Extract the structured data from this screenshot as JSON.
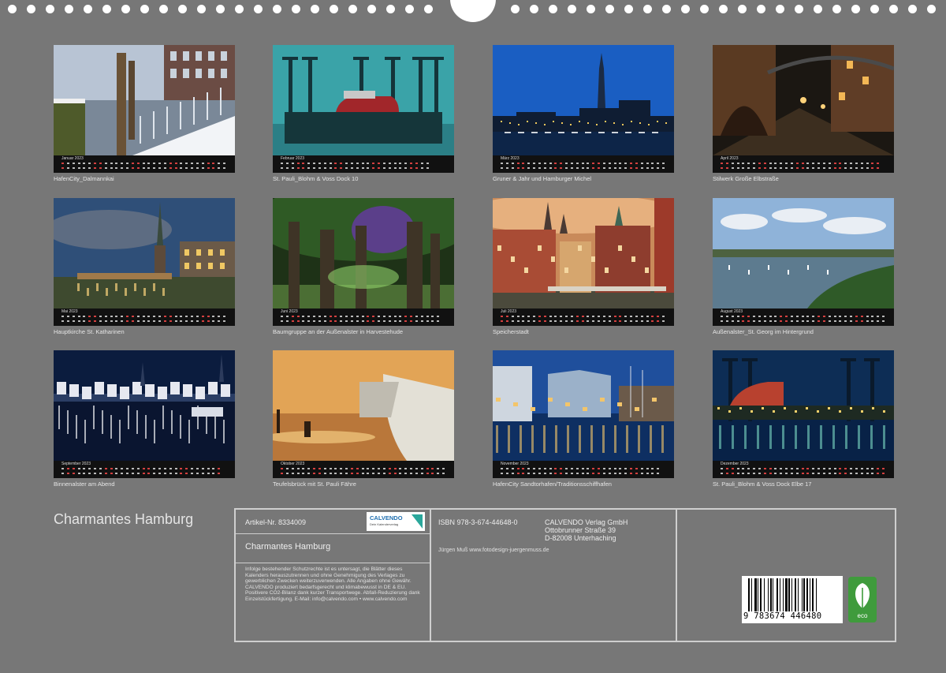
{
  "document": {
    "back_title": "Charmantes Hamburg"
  },
  "calendar_months": [
    {
      "label": "Januar 2023",
      "caption": "HafenCity_Dalmannkai",
      "theme": "winter-harbor"
    },
    {
      "label": "Februar 2023",
      "caption": "St. Pauli_Blohm & Voss Dock 10",
      "theme": "teal-dock"
    },
    {
      "label": "März 2023",
      "caption": "Gruner & Jahr und Hamburger Michel",
      "theme": "blue-skyline"
    },
    {
      "label": "April 2023",
      "caption": "Stilwerk Große Elbstraße",
      "theme": "night-street"
    },
    {
      "label": "Mai 2023",
      "caption": "Hauptkirche St. Katharinen",
      "theme": "church-canal"
    },
    {
      "label": "Juni 2023",
      "caption": "Baumgruppe an der Außenalster in Harvestehude",
      "theme": "trees"
    },
    {
      "label": "Juli 2023",
      "caption": "Speicherstadt",
      "theme": "speicherstadt"
    },
    {
      "label": "August 2023",
      "caption": "Außenalster_St. Georg im Hintergrund",
      "theme": "lake"
    },
    {
      "label": "September 2023",
      "caption": "Binnenalster am Abend",
      "theme": "night-lake"
    },
    {
      "label": "Oktober 2023",
      "caption": "Teufelsbrück mit St. Pauli Fähre",
      "theme": "golden-ferry"
    },
    {
      "label": "November 2023",
      "caption": "HafenCity Sandtorhafen/Traditionsschiffhafen",
      "theme": "blue-harbor"
    },
    {
      "label": "Dezember 2023",
      "caption": "St. Pauli_Blohm & Voss Dock Elbe 17",
      "theme": "night-dock"
    }
  ],
  "info_panel": {
    "article_label": "Artikel-Nr. 8334009",
    "logo_text": "CALVENDO",
    "logo_subtext": "Dein Kalenderverlag",
    "title": "Charmantes Hamburg",
    "legal_text": "Infolge bestehender Schutzrechte ist es untersagt, die Blätter dieses Kalenders herauszutrennen und ohne Genehmigung des Verlages zu gewerblichen Zwecken weiterzuverwenden. Alle Angaben ohne Gewähr. CALVENDO produziert bedarfsgerecht und klimabewusst in DE & EU. Positivere CO2-Bilanz dank kurzer Transportwege. Abfall-Reduzierung dank Einzelstückfertigung. E-Mail: info@calvendo.com • www.calvendo.com",
    "isbn": "ISBN 978-3-674-44648-0",
    "publisher_name": "CALVENDO Verlag GmbH",
    "publisher_street": "Ottobrunner Straße 39",
    "publisher_city": "D-82008 Unterhaching",
    "author": "Jürgen Muß  www.fotodesign-juergenmuss.de",
    "barcode_number": "9 783674 446480",
    "eco_label": "eco"
  },
  "colors": {
    "page_background": "#777777",
    "calendar_bar": "#111111",
    "weekend_mark": "#d44040",
    "eco_green": "#3f9b3c"
  }
}
